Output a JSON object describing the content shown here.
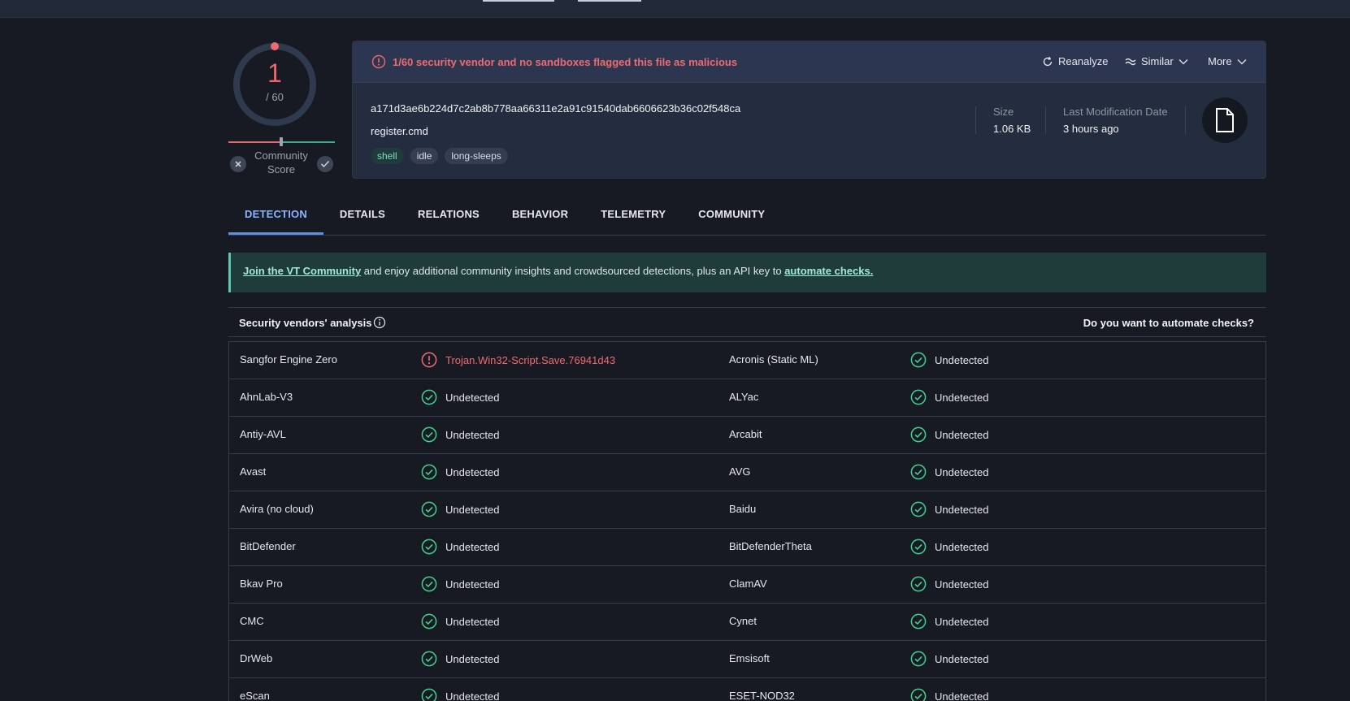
{
  "score": {
    "detections": "1",
    "total": "/ 60",
    "community_label": "Community\nScore"
  },
  "alert": {
    "text": "1/60 security vendor and no sandboxes flagged this file as malicious"
  },
  "actions": {
    "reanalyze": "Reanalyze",
    "similar": "Similar",
    "more": "More"
  },
  "file": {
    "hash": "a171d3ae6b224d7c2ab8b778aa66311e2a91c91540dab6606623b36c02f548ca",
    "name": "register.cmd",
    "tags": [
      "shell",
      "idle",
      "long-sleeps"
    ],
    "size_label": "Size",
    "size_value": "1.06 KB",
    "date_label": "Last Modification Date",
    "date_value": "3 hours ago"
  },
  "tabs": [
    "DETECTION",
    "DETAILS",
    "RELATIONS",
    "BEHAVIOR",
    "TELEMETRY",
    "COMMUNITY"
  ],
  "banner": {
    "link1": "Join the VT Community",
    "middle": " and enjoy additional community insights and crowdsourced detections, plus an API key to ",
    "link2": "automate checks."
  },
  "section": {
    "title": "Security vendors' analysis",
    "right": "Do you want to automate checks?"
  },
  "vendors": [
    {
      "left": {
        "name": "Sangfor Engine Zero",
        "result": "Trojan.Win32-Script.Save.76941d43",
        "malicious": true
      },
      "right": {
        "name": "Acronis (Static ML)",
        "result": "Undetected",
        "malicious": false
      }
    },
    {
      "left": {
        "name": "AhnLab-V3",
        "result": "Undetected",
        "malicious": false
      },
      "right": {
        "name": "ALYac",
        "result": "Undetected",
        "malicious": false
      }
    },
    {
      "left": {
        "name": "Antiy-AVL",
        "result": "Undetected",
        "malicious": false
      },
      "right": {
        "name": "Arcabit",
        "result": "Undetected",
        "malicious": false
      }
    },
    {
      "left": {
        "name": "Avast",
        "result": "Undetected",
        "malicious": false
      },
      "right": {
        "name": "AVG",
        "result": "Undetected",
        "malicious": false
      }
    },
    {
      "left": {
        "name": "Avira (no cloud)",
        "result": "Undetected",
        "malicious": false
      },
      "right": {
        "name": "Baidu",
        "result": "Undetected",
        "malicious": false
      }
    },
    {
      "left": {
        "name": "BitDefender",
        "result": "Undetected",
        "malicious": false
      },
      "right": {
        "name": "BitDefenderTheta",
        "result": "Undetected",
        "malicious": false
      }
    },
    {
      "left": {
        "name": "Bkav Pro",
        "result": "Undetected",
        "malicious": false
      },
      "right": {
        "name": "ClamAV",
        "result": "Undetected",
        "malicious": false
      }
    },
    {
      "left": {
        "name": "CMC",
        "result": "Undetected",
        "malicious": false
      },
      "right": {
        "name": "Cynet",
        "result": "Undetected",
        "malicious": false
      }
    },
    {
      "left": {
        "name": "DrWeb",
        "result": "Undetected",
        "malicious": false
      },
      "right": {
        "name": "Emsisoft",
        "result": "Undetected",
        "malicious": false
      }
    },
    {
      "left": {
        "name": "eScan",
        "result": "Undetected",
        "malicious": false
      },
      "right": {
        "name": "ESET-NOD32",
        "result": "Undetected",
        "malicious": false
      }
    }
  ],
  "colors": {
    "malicious": "#ef6a6f",
    "clean": "#3fd08d",
    "accent": "#8ab4ff"
  }
}
